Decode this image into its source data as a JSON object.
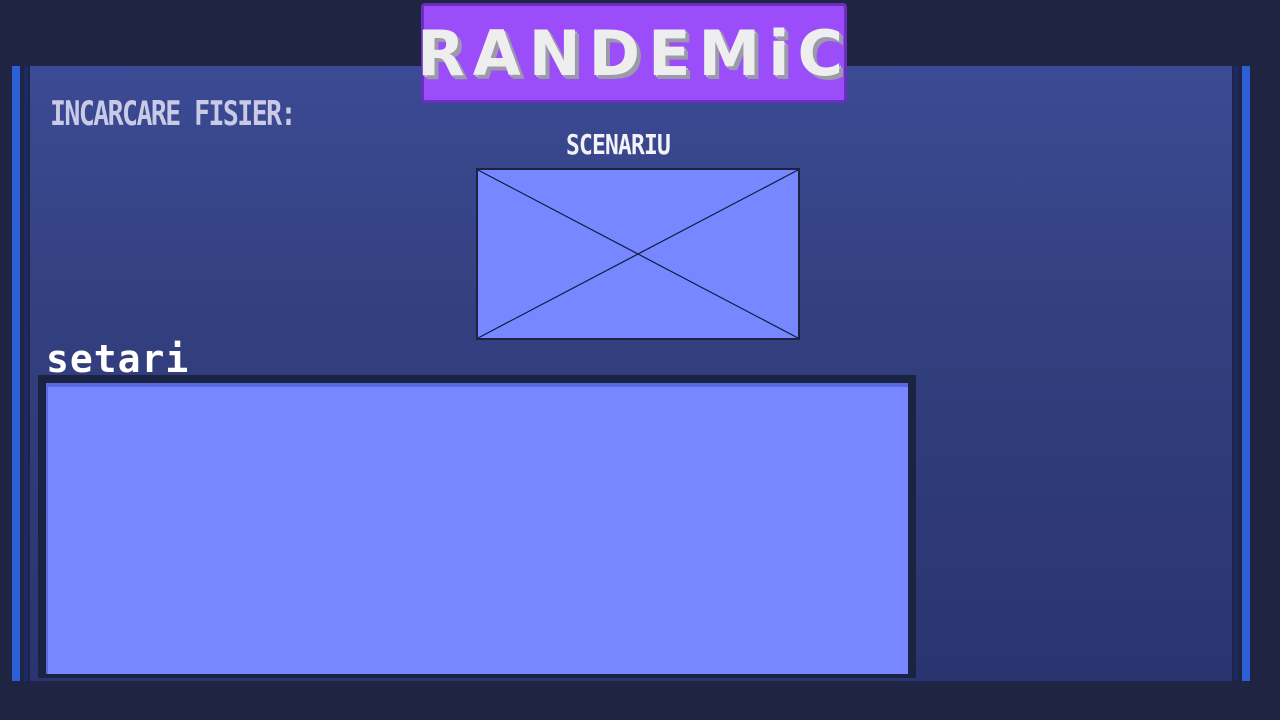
{
  "logo": {
    "title": "RANDEMiC"
  },
  "upload": {
    "heading": "INCARCARE FISIER:"
  },
  "scenario": {
    "heading": "SCENARIU"
  },
  "settings": {
    "heading": "setari"
  },
  "colors": {
    "background": "#1f2442",
    "panel": "#33407f",
    "logo_bg": "#9b4dfa",
    "slot_fill": "#7787ff",
    "rail_stripe": "#2d5fd6"
  }
}
